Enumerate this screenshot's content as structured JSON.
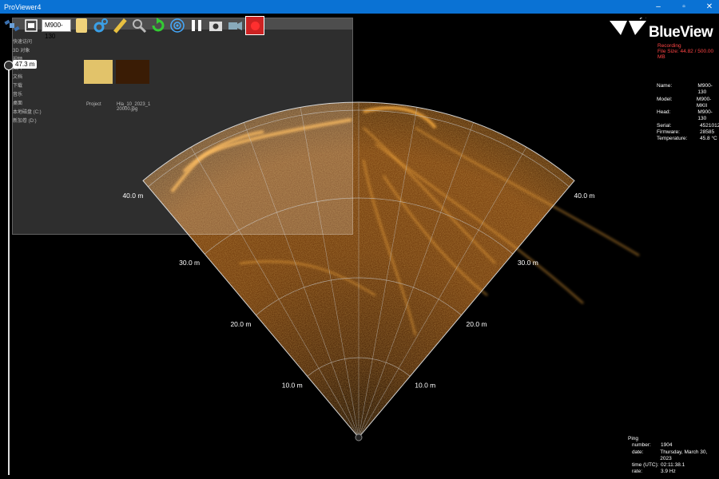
{
  "window": {
    "title": "ProViewer4",
    "controls": {
      "minimize": "–",
      "maximize": "▫",
      "close": "✕"
    }
  },
  "toolbar": {
    "head_select_value": "M900-130"
  },
  "depth_marker": {
    "label": "47.3 m"
  },
  "range_labels": [
    "10.0 m",
    "20.0 m",
    "30.0 m",
    "40.0 m"
  ],
  "brand": {
    "name": "BlueView",
    "recording": "Recording",
    "file_size": "File Size: 44.82 / 500.00 MB"
  },
  "info": [
    {
      "k": "Name:",
      "v": "M900-130"
    },
    {
      "k": "Model:",
      "v": "M900-MKII"
    },
    {
      "k": "Head:",
      "v": "M900-130"
    },
    {
      "k": "Serial:",
      "v": "4521012"
    },
    {
      "k": "Firmware:",
      "v": "28585"
    },
    {
      "k": "Temperature:",
      "v": "45.8 °C"
    }
  ],
  "ping": {
    "heading": "Ping",
    "rows": [
      {
        "k": "number:",
        "v": "1904"
      },
      {
        "k": "date:",
        "v": "Thursday, March 30, 2023"
      },
      {
        "k": "time (UTC):",
        "v": "02:11:38.1"
      },
      {
        "k": "rate:",
        "v": "3.9 Hz"
      }
    ]
  },
  "background_window": {
    "sidebar": [
      "快速访问",
      "3D 对象",
      "视频",
      "图片",
      "文档",
      "下载",
      "音乐",
      "桌面",
      "本地磁盘 (C:)",
      "新加卷 (D:)"
    ],
    "files": [
      "Project",
      "Hla_10_2023_1 20000.jpg"
    ]
  },
  "colors": {
    "titlebar": "#0a72d4",
    "sonar_hot": "#ffb040",
    "recording": "#ff4444"
  }
}
